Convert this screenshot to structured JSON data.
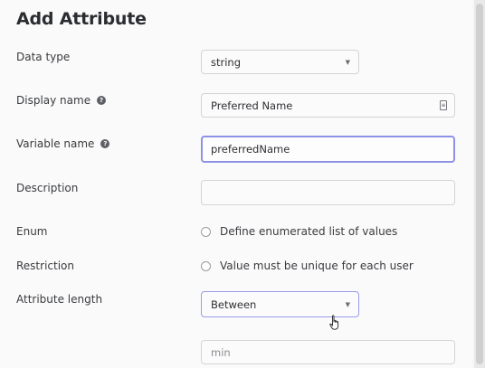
{
  "dialog": {
    "title": "Add Attribute"
  },
  "fields": {
    "data_type": {
      "label": "Data type",
      "value": "string"
    },
    "display_name": {
      "label": "Display name",
      "value": "Preferred Name"
    },
    "variable_name": {
      "label": "Variable name",
      "value": "preferredName"
    },
    "description": {
      "label": "Description",
      "value": ""
    },
    "enum": {
      "label": "Enum",
      "option": "Define enumerated list of values"
    },
    "restriction": {
      "label": "Restriction",
      "option": "Value must be unique for each user"
    },
    "attribute_length": {
      "label": "Attribute length",
      "value": "Between"
    },
    "min": {
      "placeholder": "min"
    }
  },
  "icons": {
    "help": "question-circle-icon",
    "caret": "chevron-down-icon",
    "field_icon": "text-field-icon",
    "cursor": "pointer-hand-icon"
  },
  "colors": {
    "focus_border": "#8e92e6",
    "help_icon": "#5f6066"
  }
}
